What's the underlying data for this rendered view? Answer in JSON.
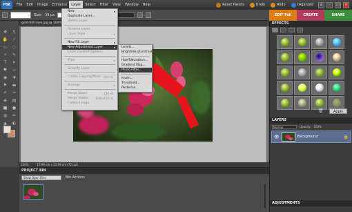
{
  "menubar": {
    "logo": "PSE",
    "items": [
      "File",
      "Edit",
      "Image",
      "Enhance",
      "Layer",
      "Select",
      "Filter",
      "View",
      "Window",
      "Help"
    ],
    "active_index": 4,
    "reset_panels": "Reset Panels",
    "undo": "Undo",
    "redo": "Redo",
    "organizer": "Organizer"
  },
  "options_bar": {
    "size_label": "Size:",
    "size_value": "39 px"
  },
  "mode_tabs": [
    "EDIT Full",
    "CREATE",
    "SHARE"
  ],
  "document": {
    "tab_title": "gold-tint-rose.jpg @ 100% (RGB/8)",
    "zoom": "100%",
    "dimensions": "17.99 cm x 11.99 cm (72 ppi)"
  },
  "layer_menu": {
    "items": [
      {
        "label": "New",
        "type": "sub",
        "disabled": false
      },
      {
        "label": "Duplicate Layer...",
        "disabled": false
      },
      {
        "label": "Delete Layer",
        "disabled": true
      },
      {
        "sep": true
      },
      {
        "label": "Rename Layer...",
        "disabled": true
      },
      {
        "label": "Layer Style",
        "type": "sub",
        "disabled": true
      },
      {
        "sep": true
      },
      {
        "label": "New Fill Layer",
        "type": "sub",
        "disabled": false
      },
      {
        "label": "New Adjustment Layer",
        "type": "sub",
        "disabled": false,
        "highlight": true
      },
      {
        "label": "Layer Content Options...",
        "disabled": true
      },
      {
        "sep": true
      },
      {
        "label": "Type",
        "type": "sub",
        "disabled": true
      },
      {
        "sep": true
      },
      {
        "label": "Simplify Layer",
        "disabled": true
      },
      {
        "sep": true
      },
      {
        "label": "Create Clipping Mask",
        "shortcut": "Ctrl+G",
        "disabled": true
      },
      {
        "sep": true
      },
      {
        "label": "Arrange",
        "type": "sub",
        "disabled": true
      },
      {
        "sep": true
      },
      {
        "label": "Merge Down",
        "shortcut": "Ctrl+E",
        "disabled": true
      },
      {
        "label": "Merge Visible",
        "shortcut": "Shift+Ctrl+E",
        "disabled": true
      },
      {
        "label": "Flatten Image",
        "disabled": true
      }
    ]
  },
  "adjustment_submenu": {
    "items": [
      {
        "label": "Levels..."
      },
      {
        "label": "Brightness/Contrast..."
      },
      {
        "sep": true
      },
      {
        "label": "Hue/Saturation..."
      },
      {
        "label": "Gradient Map..."
      },
      {
        "label": "Photo Filter...",
        "highlight": true
      },
      {
        "sep": true
      },
      {
        "label": "Invert..."
      },
      {
        "label": "Threshold..."
      },
      {
        "label": "Posterize..."
      }
    ]
  },
  "project_bin": {
    "title": "PROJECT BIN",
    "show": "Show Open Files",
    "actions": "Bin Actions"
  },
  "effects_panel": {
    "title": "EFFECTS",
    "apply": "Apply"
  },
  "layers_panel": {
    "title": "LAYERS",
    "blend_mode": "Normal",
    "opacity_label": "Opacity:",
    "opacity_value": "100%",
    "layer_name": "Background"
  },
  "adjustments_panel": {
    "title": "ADJUSTMENTS"
  },
  "colors": {
    "accent_edit": "#e07b12",
    "create": "#b23a5a",
    "share": "#3d8f3d",
    "arrow": "#e8141c"
  }
}
